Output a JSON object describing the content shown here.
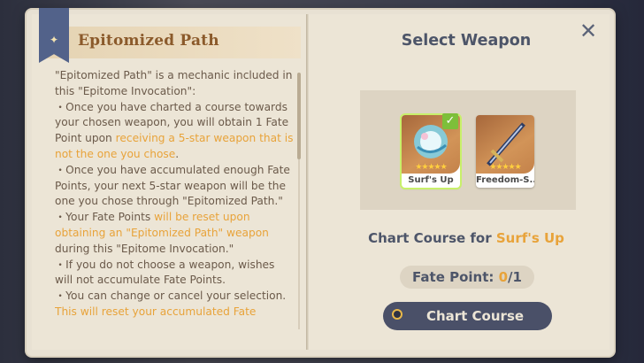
{
  "left_page": {
    "title": "Epitomized Path",
    "intro": "\"Epitomized Path\" is a mechanic included in this \"Epitome Invocation\":",
    "bullet1_pre": "・Once you have charted a course towards your chosen weapon, you will obtain 1 Fate Point upon ",
    "bullet1_hl": "receiving a 5-star weapon that is not the one you chose",
    "bullet1_post": ".",
    "bullet2": "・Once you have accumulated enough Fate Points, your next 5-star weapon will be the one you chose through \"Epitomized Path.\"",
    "bullet3_pre": "・Your Fate Points ",
    "bullet3_hl": "will be reset upon obtaining an \"Epitomized Path\" weapon",
    "bullet3_post": " during this \"Epitome Invocation.\"",
    "bullet4": "・If you do not choose a weapon, wishes will not accumulate Fate Points.",
    "bullet5": "・You can change or cancel your selection.",
    "bullet5_hl": "This will reset your accumulated Fate"
  },
  "right_page": {
    "title": "Select Weapon",
    "weapons": [
      {
        "name": "Surf's Up",
        "stars": "★★★★★",
        "selected": true
      },
      {
        "name": "Freedom-S...",
        "stars": "★★★★★",
        "selected": false
      }
    ],
    "chart_course_prefix": "Chart Course for ",
    "chart_course_weapon": "Surf's Up",
    "fate_label": "Fate Point: ",
    "fate_current": "0",
    "fate_max": "/1",
    "button_label": "Chart Course"
  },
  "icons": {
    "bookmark": "star-bookmark-icon",
    "close": "close-icon",
    "check": "checkmark-icon",
    "button": "circle-icon"
  },
  "colors": {
    "highlight": "#e8a33a",
    "title_brown": "#8b5a2b",
    "button_bg": "#4a5068",
    "bookmark": "#52628a"
  }
}
